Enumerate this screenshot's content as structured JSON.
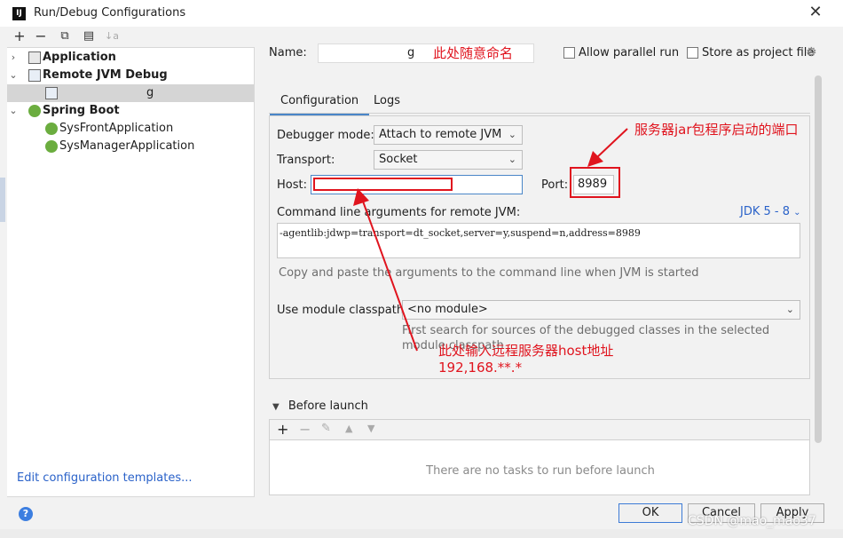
{
  "window": {
    "title": "Run/Debug Configurations",
    "logo_text": "IJ"
  },
  "toolbar_left": {
    "add": "+",
    "remove": "−",
    "copy": "⧉",
    "folder": "▤",
    "sort": "↓a"
  },
  "tree": {
    "items": [
      {
        "label": "Application"
      },
      {
        "label": "Remote JVM Debug"
      },
      {
        "label": "g"
      },
      {
        "label": "Spring Boot"
      },
      {
        "label": "SysFrontApplication"
      },
      {
        "label": "SysManagerApplication"
      }
    ]
  },
  "edit_templates_link": "Edit configuration templates...",
  "help_label": "?",
  "form": {
    "name_label": "Name:",
    "name_value": "g",
    "allow_parallel_label": "Allow parallel run",
    "store_project_label": "Store as project file",
    "tabs": [
      {
        "label": "Configuration"
      },
      {
        "label": "Logs"
      }
    ],
    "debugger_mode_label": "Debugger mode:",
    "debugger_mode_value": "Attach to remote JVM",
    "transport_label": "Transport:",
    "transport_value": "Socket",
    "host_label": "Host:",
    "host_value": "",
    "port_label": "Port:",
    "port_value": "8989",
    "cmd_label": "Command line arguments for remote JVM:",
    "jdk_selector": "JDK 5 - 8",
    "cmd_value": "-agentlib:jdwp=transport=dt_socket,server=y,suspend=n,address=8989",
    "cmd_hint": "Copy and paste the arguments to the command line when JVM is started",
    "module_label": "Use module classpath:",
    "module_value": "<no module>",
    "module_hint_line1": "First search for sources of the debugged classes in the selected",
    "module_hint_line2": "module classpath"
  },
  "before_launch": {
    "title": "Before launch",
    "empty_text": "There are no tasks to run before launch"
  },
  "buttons": {
    "ok": "OK",
    "cancel": "Cancel",
    "apply": "Apply"
  },
  "annotations": {
    "name_note": "此处随意命名",
    "port_note": "服务器jar包程序启动的端口",
    "host_note_line1": "此处输入远程服务器host地址",
    "host_note_line2": "192,168.**.*"
  },
  "watermark": "CSDN @mao_mao37",
  "colors": {
    "annotation": "#e0141e",
    "link": "#2a62c9",
    "selection": "#d5d5d5"
  }
}
